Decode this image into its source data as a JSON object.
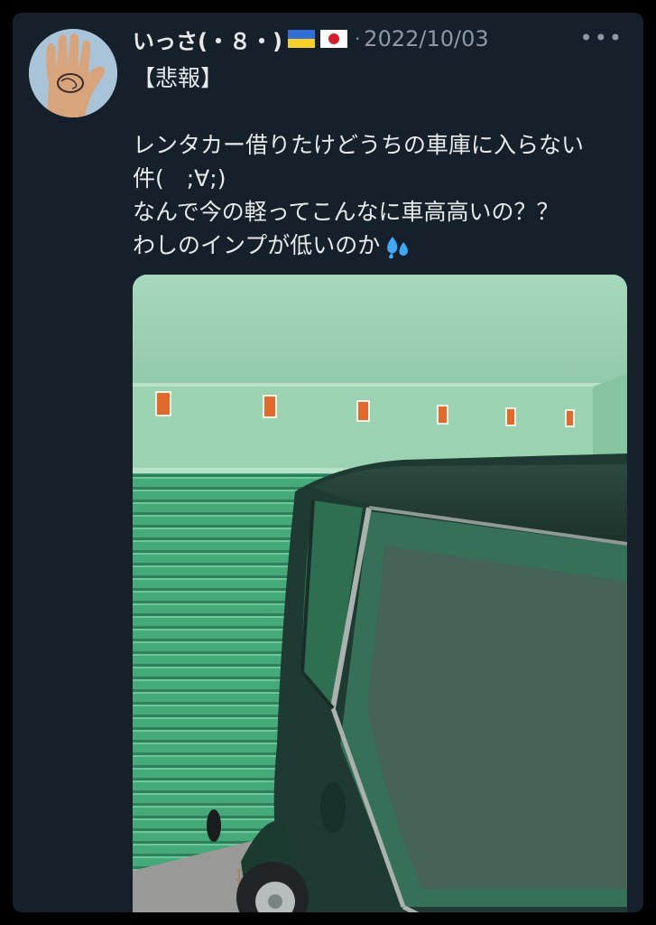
{
  "tweet": {
    "display_name": "いっさ(・８・)",
    "flags": [
      "ukraine-flag",
      "japan-flag"
    ],
    "separator": "·",
    "date": "2022/10/03",
    "more_label": "•••",
    "title_line": "【悲報】",
    "body_lines": [
      "レンタカー借りたけどうちの車庫に入らない",
      "件(　;∀;)",
      "なんで今の軽ってこんなに車高高いの？？",
      "わしのインプが低いのか"
    ],
    "trailing_emoji": "sweat-droplets-icon"
  },
  "colors": {
    "background": "#15202b",
    "primary_text": "#e7e9ea",
    "secondary_text": "#8b98a5",
    "garage_green": "#4fb383",
    "car_dark_green": "#1f3a32"
  }
}
